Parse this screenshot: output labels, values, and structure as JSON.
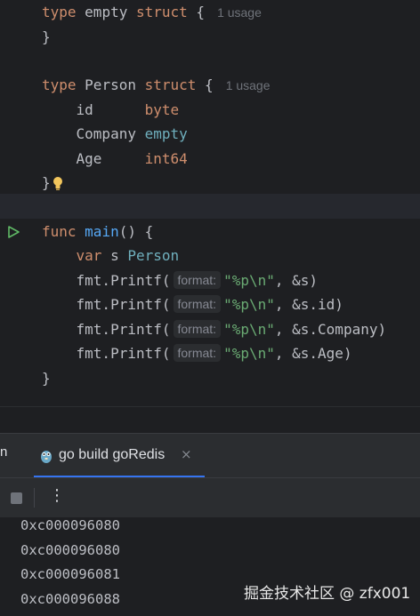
{
  "editor": {
    "usage_hint": "1 usage",
    "param_hint": "format:",
    "lines": {
      "l1": {
        "kw1": "type",
        "name": "empty",
        "kw2": "struct",
        "brace": "{"
      },
      "l2": {
        "brace": "}"
      },
      "l4": {
        "kw1": "type",
        "name": "Person",
        "kw2": "struct",
        "brace": "{"
      },
      "l5": {
        "field": "id",
        "type": "byte"
      },
      "l6": {
        "field": "Company",
        "type": "empty"
      },
      "l7": {
        "field": "Age",
        "type": "int64"
      },
      "l8": {
        "brace": "}"
      },
      "l10": {
        "kw": "func",
        "name": "main",
        "rest": "() {"
      },
      "l11": {
        "kw": "var",
        "mid": "s",
        "type": "Person"
      },
      "printf_call": "fmt.Printf(",
      "printf_fmt": "\"%p\\n\"",
      "l12": {
        "arg": ", &s)"
      },
      "l13": {
        "arg": ", &s.id)"
      },
      "l14": {
        "arg": ", &s.Company)"
      },
      "l15": {
        "arg": ", &s.Age)"
      },
      "l16": {
        "brace": "}"
      }
    }
  },
  "tool_window": {
    "partial_tab": "n",
    "tab_label": "go build goRedis",
    "close_glyph": "×",
    "more_glyph": "⋮"
  },
  "console": {
    "lines": [
      "0xc000096080",
      "0xc000096080",
      "0xc000096081",
      "0xc000096088"
    ]
  },
  "watermark": "掘金技术社区 @ zfx001",
  "colors": {
    "background": "#1e1f22",
    "keyword": "#cf8e6d",
    "type": "#6fafbd",
    "function": "#56a8f5",
    "string": "#6aab73",
    "accent": "#3574f0"
  }
}
